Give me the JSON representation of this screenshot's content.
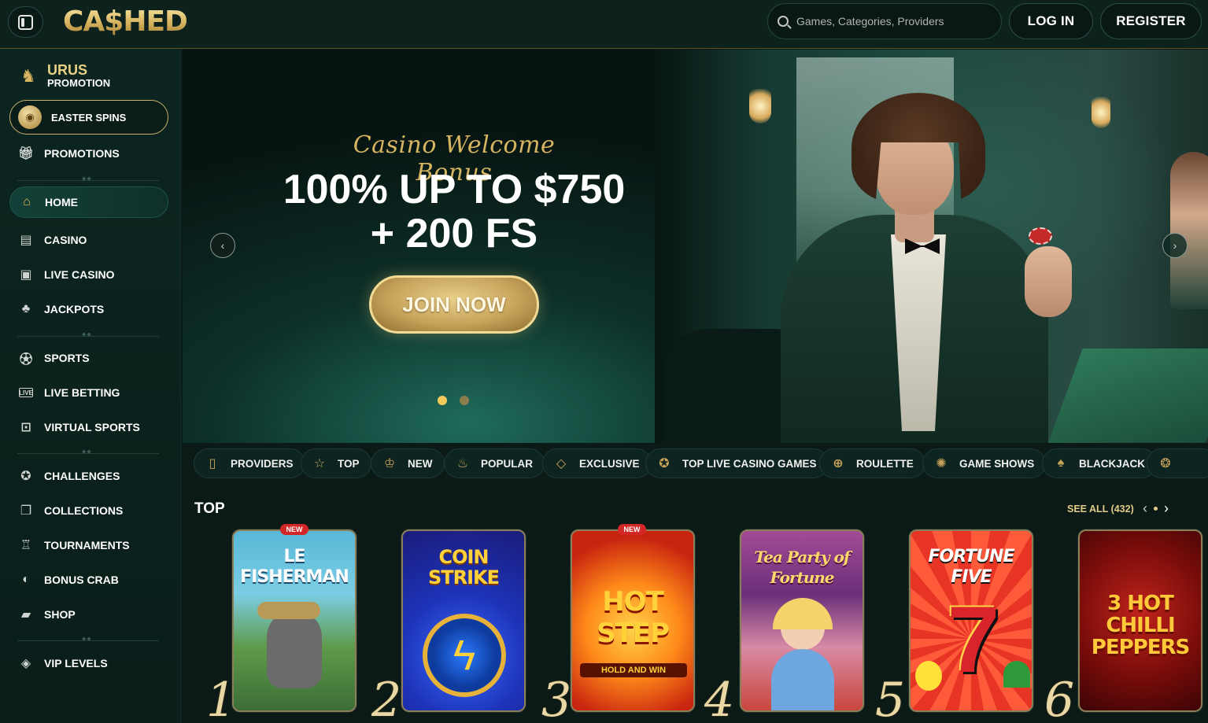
{
  "header": {
    "logo": "CA$HED",
    "search_placeholder": "Games, Categories, Providers",
    "login_label": "LOG IN",
    "register_label": "REGISTER"
  },
  "sidebar": {
    "promo_line1": "URUS",
    "promo_line2": "PROMOTION",
    "easter_label": "EASTER SPINS",
    "promotions_label": "PROMOTIONS",
    "items": [
      {
        "label": "HOME",
        "icon": "home-icon"
      },
      {
        "label": "CASINO",
        "icon": "slot-machine-icon"
      },
      {
        "label": "LIVE CASINO",
        "icon": "live-casino-icon"
      },
      {
        "label": "JACKPOTS",
        "icon": "clover-icon"
      },
      {
        "label": "SPORTS",
        "icon": "soccer-ball-icon"
      },
      {
        "label": "LIVE BETTING",
        "icon": "live-icon"
      },
      {
        "label": "VIRTUAL SPORTS",
        "icon": "virtual-sports-icon"
      },
      {
        "label": "CHALLENGES",
        "icon": "challenges-icon"
      },
      {
        "label": "COLLECTIONS",
        "icon": "collections-icon"
      },
      {
        "label": "TOURNAMENTS",
        "icon": "trophy-icon"
      },
      {
        "label": "BONUS CRAB",
        "icon": "bonus-crab-icon"
      },
      {
        "label": "SHOP",
        "icon": "shop-bag-icon"
      },
      {
        "label": "VIP LEVELS",
        "icon": "diamond-icon"
      }
    ]
  },
  "hero": {
    "subtitle": "Casino Welcome Bonus",
    "title_line1": "100% UP TO $750",
    "title_line2": "+ 200 FS",
    "cta_label": "JOIN NOW",
    "slides": 2,
    "active_slide": 1
  },
  "categories": [
    {
      "label": "PROVIDERS",
      "icon": "book-icon"
    },
    {
      "label": "TOP",
      "icon": "star-icon"
    },
    {
      "label": "NEW",
      "icon": "new-icon"
    },
    {
      "label": "POPULAR",
      "icon": "flame-icon"
    },
    {
      "label": "EXCLUSIVE",
      "icon": "gem-icon"
    },
    {
      "label": "TOP LIVE CASINO GAMES",
      "icon": "medal-icon"
    },
    {
      "label": "ROULETTE",
      "icon": "roulette-icon"
    },
    {
      "label": "GAME SHOWS",
      "icon": "wheel-icon"
    },
    {
      "label": "BLACKJACK",
      "icon": "cards-icon"
    }
  ],
  "top_section": {
    "title": "TOP",
    "see_all": "SEE ALL (432)",
    "games": [
      {
        "rank": "1",
        "name": "LE FISHERMAN",
        "badge": "NEW"
      },
      {
        "rank": "2",
        "name": "COIN STRIKE",
        "badge": ""
      },
      {
        "rank": "3",
        "name": "HOT STEP",
        "badge": "NEW"
      },
      {
        "rank": "4",
        "name": "Tea Party of Fortune",
        "badge": ""
      },
      {
        "rank": "5",
        "name": "FORTUNE FIVE",
        "badge": ""
      },
      {
        "rank": "6",
        "name": "3 HOT CHILLI PEPPERS",
        "badge": ""
      }
    ]
  }
}
